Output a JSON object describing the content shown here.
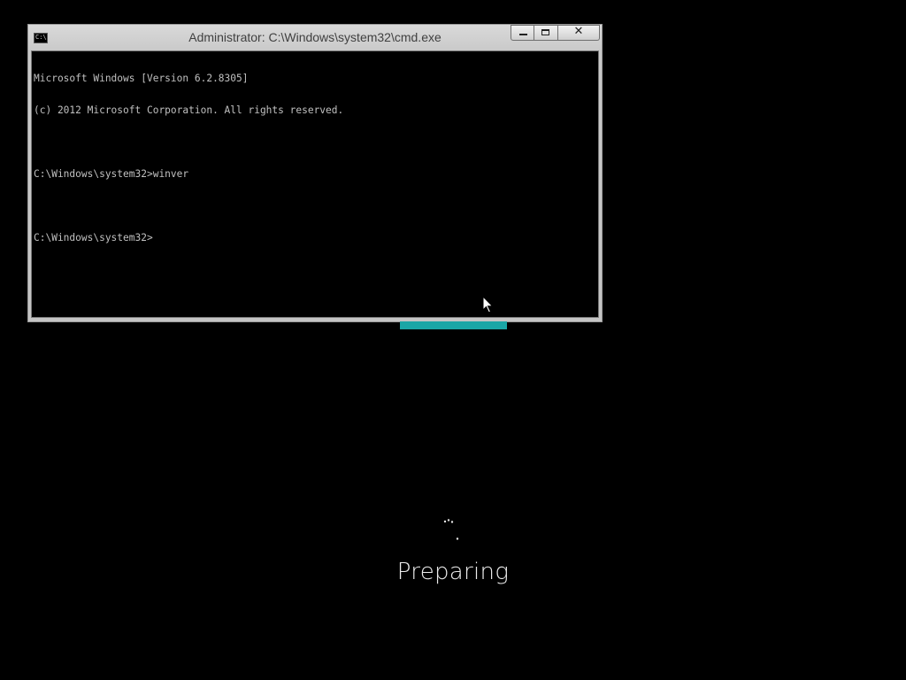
{
  "window": {
    "title": "Administrator: C:\\Windows\\system32\\cmd.exe",
    "icon": "cmd-icon",
    "icon_label": "C:\\",
    "buttons": {
      "minimize": "minimize-icon",
      "maximize": "maximize-icon",
      "close": "close-icon",
      "close_glyph": "✕"
    }
  },
  "console": {
    "lines": [
      "Microsoft Windows [Version 6.2.8305]",
      "(c) 2012 Microsoft Corporation. All rights reserved.",
      "",
      "C:\\Windows\\system32>winver",
      "",
      "C:\\Windows\\system32>"
    ],
    "text_color": "#c0c0c0",
    "background": "#000000"
  },
  "progress": {
    "fraction": 1.0,
    "color": "#1aa6a6"
  },
  "setup": {
    "spinner": "loading-spinner-icon",
    "status": "Preparing"
  },
  "colors": {
    "desktop": "#000000",
    "accent": "#1aa6a6"
  }
}
